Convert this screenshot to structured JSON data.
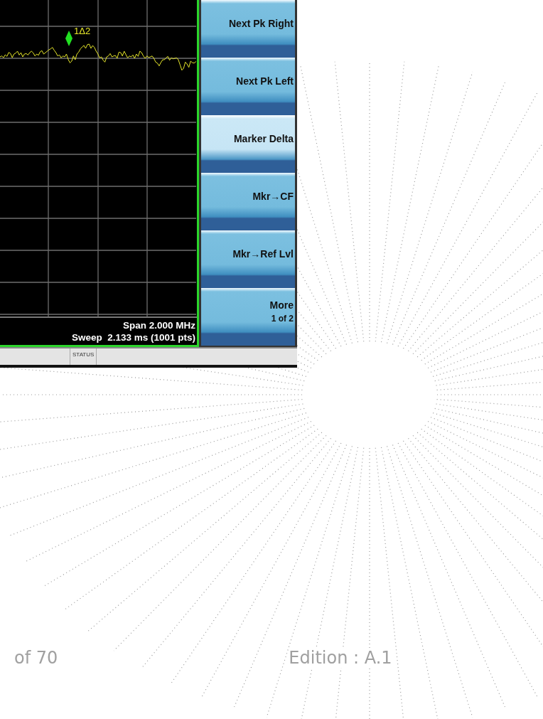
{
  "screen": {
    "marker": {
      "label": "1Δ2"
    },
    "info": [
      "Span 2.000 MHz",
      "Sweep  2.133 ms (1001 pts)"
    ],
    "softkeys": [
      {
        "label": "Next Pk Right",
        "selected": false
      },
      {
        "label": "Next Pk Left",
        "selected": false
      },
      {
        "label": "Marker Delta",
        "selected": true
      },
      {
        "label": "Mkr→CF",
        "selected": false
      },
      {
        "label": "Mkr→Ref Lvl",
        "selected": false
      },
      {
        "label": "More",
        "sublabel": "1 of 2",
        "selected": false
      }
    ],
    "status_bar": {
      "label": "STATUS"
    }
  },
  "footer": {
    "page": "of 70",
    "edition": "Edition : A.1"
  }
}
